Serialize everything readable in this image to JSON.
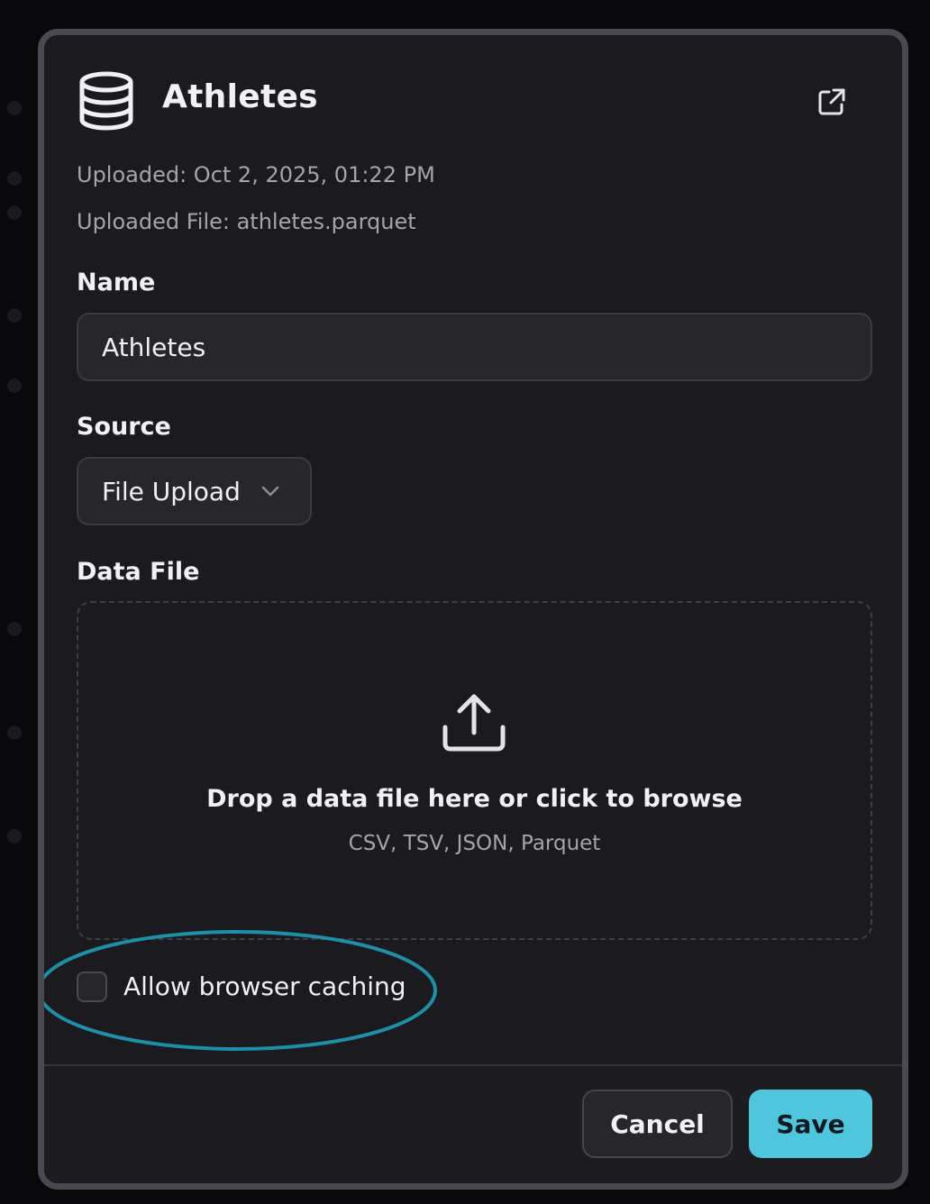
{
  "dialog": {
    "title": "Athletes",
    "uploaded_at": "Uploaded: Oct 2, 2025, 01:22 PM",
    "uploaded_file": "Uploaded File: athletes.parquet",
    "icons": {
      "dataset": "database-icon",
      "open_external": "external-link-icon"
    }
  },
  "form": {
    "name_label": "Name",
    "name_value": "Athletes",
    "source_label": "Source",
    "source_value": "File Upload",
    "data_file_label": "Data File",
    "dropzone_text": "Drop a data file here or click to browse",
    "dropzone_formats": "CSV, TSV, JSON, Parquet",
    "caching_label": "Allow browser caching",
    "caching_checked": false
  },
  "footer": {
    "cancel_label": "Cancel",
    "save_label": "Save"
  },
  "colors": {
    "accent": "#4fc6de",
    "highlight_ring": "#1f8fa8",
    "panel": "#1a1a1f"
  }
}
